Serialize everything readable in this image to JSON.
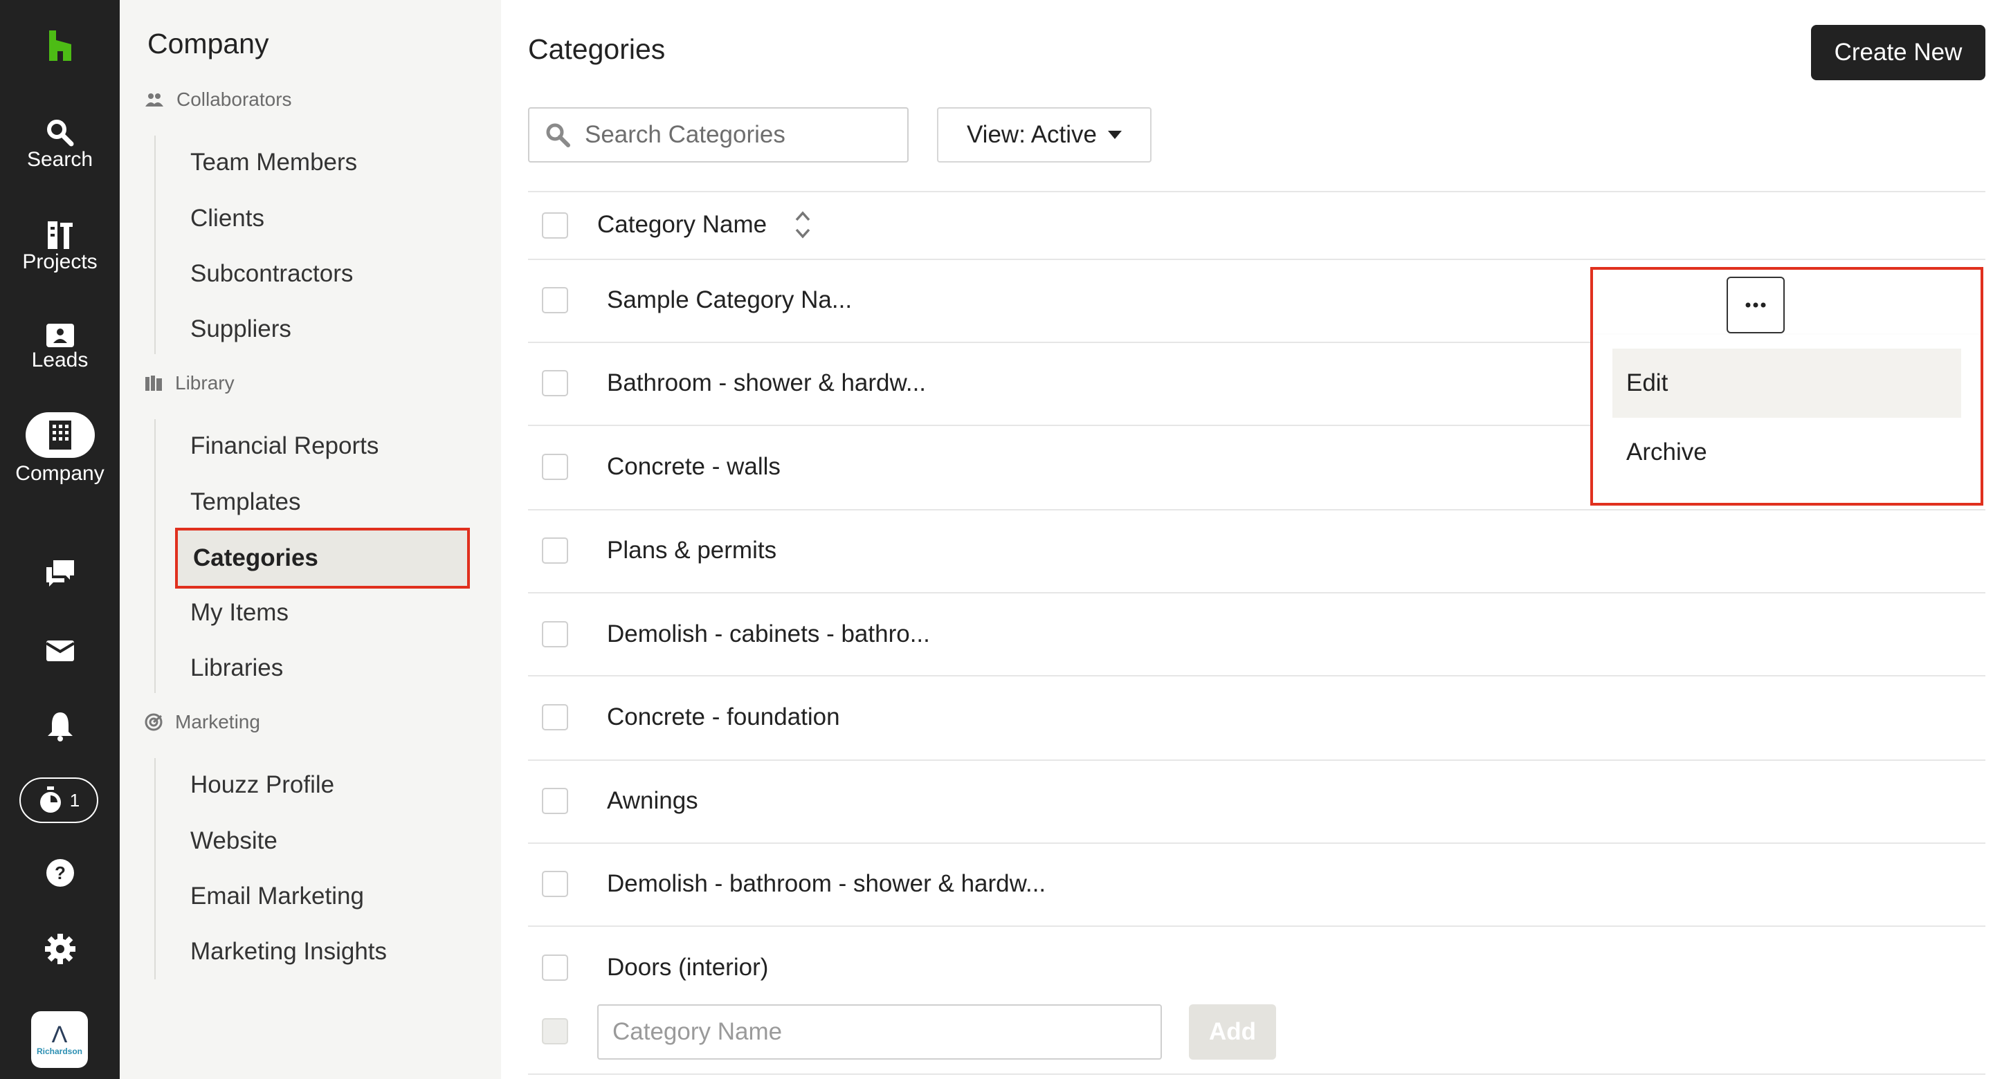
{
  "rail": {
    "items": [
      {
        "label": "Search",
        "icon": "search-icon"
      },
      {
        "label": "Projects",
        "icon": "projects-icon"
      },
      {
        "label": "Leads",
        "icon": "leads-icon"
      },
      {
        "label": "Company",
        "icon": "company-building-icon"
      }
    ],
    "timer_count": "1",
    "avatar_mark": "Λ",
    "avatar_name": "Richardson"
  },
  "sidebar": {
    "heading": "Company",
    "groups": [
      {
        "title": "Collaborators",
        "icon": "collaborators-icon",
        "items": [
          "Team Members",
          "Clients",
          "Subcontractors",
          "Suppliers"
        ]
      },
      {
        "title": "Library",
        "icon": "library-icon",
        "items": [
          "Financial Reports",
          "Templates",
          "Categories",
          "My Items",
          "Libraries"
        ]
      },
      {
        "title": "Marketing",
        "icon": "marketing-icon",
        "items": [
          "Houzz Profile",
          "Website",
          "Email Marketing",
          "Marketing Insights"
        ]
      }
    ],
    "active_item": "Categories"
  },
  "main": {
    "title": "Categories",
    "create_button": "Create New",
    "search_placeholder": "Search Categories",
    "view_filter": "View: Active",
    "column_header": "Category Name",
    "rows": [
      "Sample Category Na...",
      "Bathroom - shower & hardw...",
      "Concrete - walls",
      "Plans & permits",
      "Demolish - cabinets - bathro...",
      "Concrete - foundation",
      "Awnings",
      "Demolish - bathroom - shower & hardw...",
      "Doors (interior)"
    ],
    "add_placeholder": "Category Name",
    "add_button": "Add"
  },
  "dropdown": {
    "items": [
      "Edit",
      "Archive"
    ]
  },
  "colors": {
    "rail_bg": "#222222",
    "brand_green": "#4dbc15",
    "highlight_red": "#e0301e",
    "sidebar_bg": "#f5f5f3"
  }
}
